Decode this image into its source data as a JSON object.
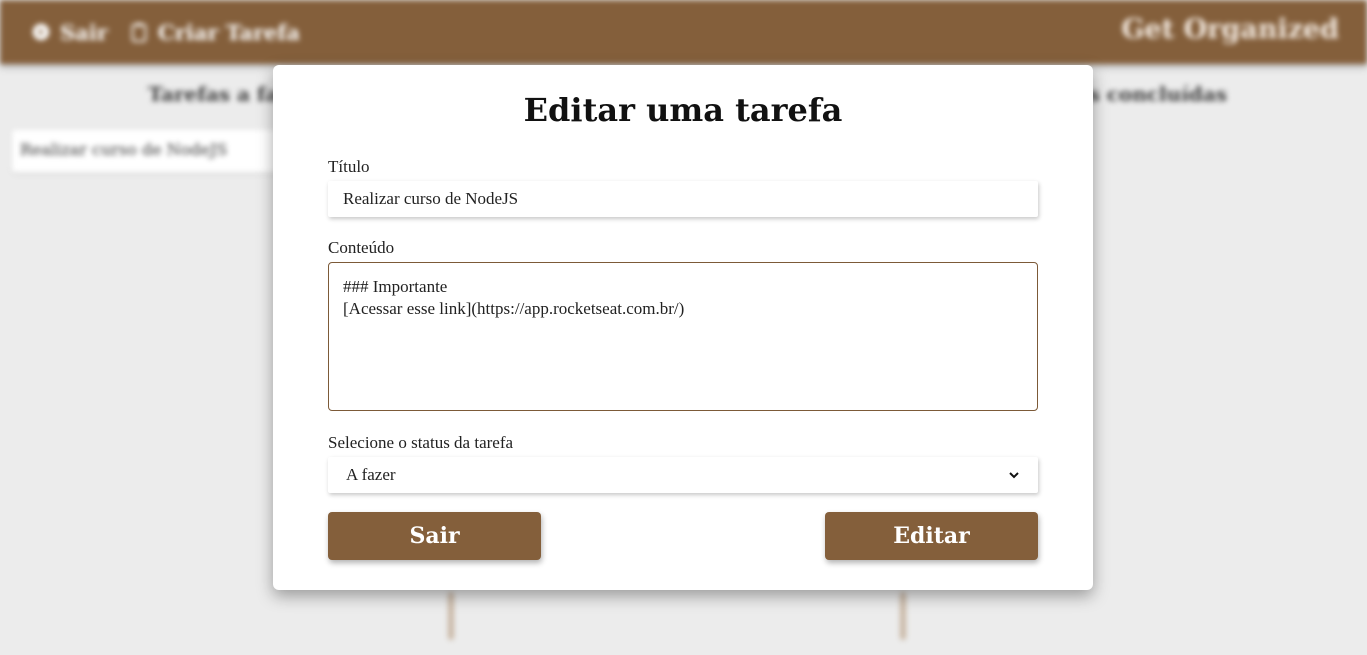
{
  "topbar": {
    "exit_label": "Sair",
    "create_label": "Criar Tarefa",
    "brand": "Get Organized"
  },
  "board": {
    "todo_title": "Tarefas a fazer",
    "done_title": "Tarefas concluídas",
    "todo_tasks": [
      "Realizar curso de NodeJS"
    ]
  },
  "modal": {
    "title": "Editar uma tarefa",
    "title_label": "Título",
    "title_value": "Realizar curso de NodeJS",
    "content_label": "Conteúdo",
    "content_value": "### Importante\n[Acessar esse link](https://app.rocketseat.com.br/)",
    "status_label": "Selecione o status da tarefa",
    "status_value": "A fazer",
    "exit_button": "Sair",
    "edit_button": "Editar"
  },
  "colors": {
    "brand_brown": "#845f3b",
    "background": "#ececec"
  },
  "icons": {
    "exit": "door-exit-icon",
    "create": "clipboard-icon",
    "select": "chevron-down-icon"
  }
}
